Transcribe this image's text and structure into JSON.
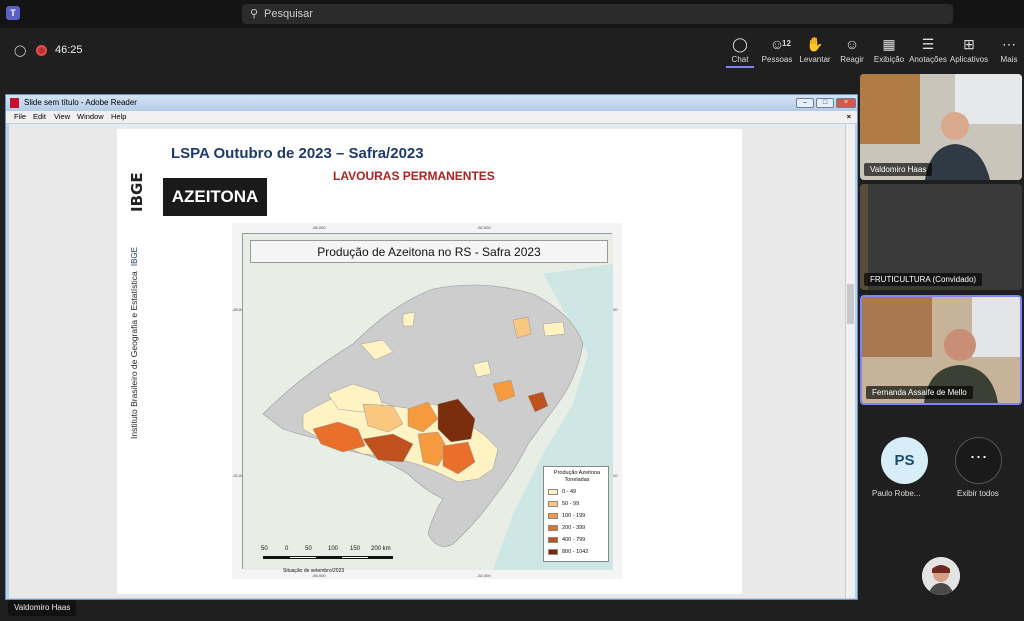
{
  "app": {
    "search_placeholder": "Pesquisar",
    "meeting_timer": "46:25"
  },
  "toolbar": {
    "chat": "Chat",
    "people": "Pessoas",
    "people_count": "12",
    "raise": "Levantar",
    "react": "Reagir",
    "view": "Exibição",
    "notes": "Anotações",
    "apps": "Aplicativos",
    "more": "Mais"
  },
  "reader": {
    "title": "Slide sem título - Adobe Reader",
    "menu": [
      "File",
      "Edit",
      "View",
      "Window",
      "Help"
    ],
    "close_doc": "×"
  },
  "slide": {
    "logo": "IBGE",
    "institute": "Instituto Brasileiro de Geografia e Estatística",
    "institute_short": "IBGE",
    "title": "LSPA Outubro de 2023 – Safra/2023",
    "subtitle": "LAVOURAS PERMANENTES",
    "crop": "AZEITONA",
    "map": {
      "title": "Produção de Azeitona no RS - Safra 2023",
      "legend_title": "Produção Azeitona Toneladas",
      "legend": [
        {
          "label": "0 - 49",
          "color": "#fff3c4"
        },
        {
          "label": "50 - 99",
          "color": "#f9c77d"
        },
        {
          "label": "100 - 199",
          "color": "#f59a3e"
        },
        {
          "label": "200 - 399",
          "color": "#e8702a"
        },
        {
          "label": "400 - 799",
          "color": "#c0501e"
        },
        {
          "label": "800 - 1042",
          "color": "#7a2e0e"
        }
      ],
      "scale_labels": [
        "50",
        "0",
        "50",
        "100",
        "150",
        "200 km"
      ],
      "situation": "Situação de setembro/2023",
      "coords": [
        "-56,000",
        "-52,000",
        "-56,000",
        "-52,000",
        "-28,000",
        "-28,000",
        "-32,000",
        "-32,000"
      ]
    }
  },
  "participants": {
    "presenter": "Valdomiro Haas",
    "tiles": [
      {
        "name": "Valdomiro Haas"
      },
      {
        "name": "FRUTICULTURA (Convidado)"
      },
      {
        "name": "Fernanda Assaife de Mello"
      }
    ],
    "ps_initials": "PS",
    "ps_name": "Paulo Robe...",
    "show_all": "Exibir todos"
  }
}
